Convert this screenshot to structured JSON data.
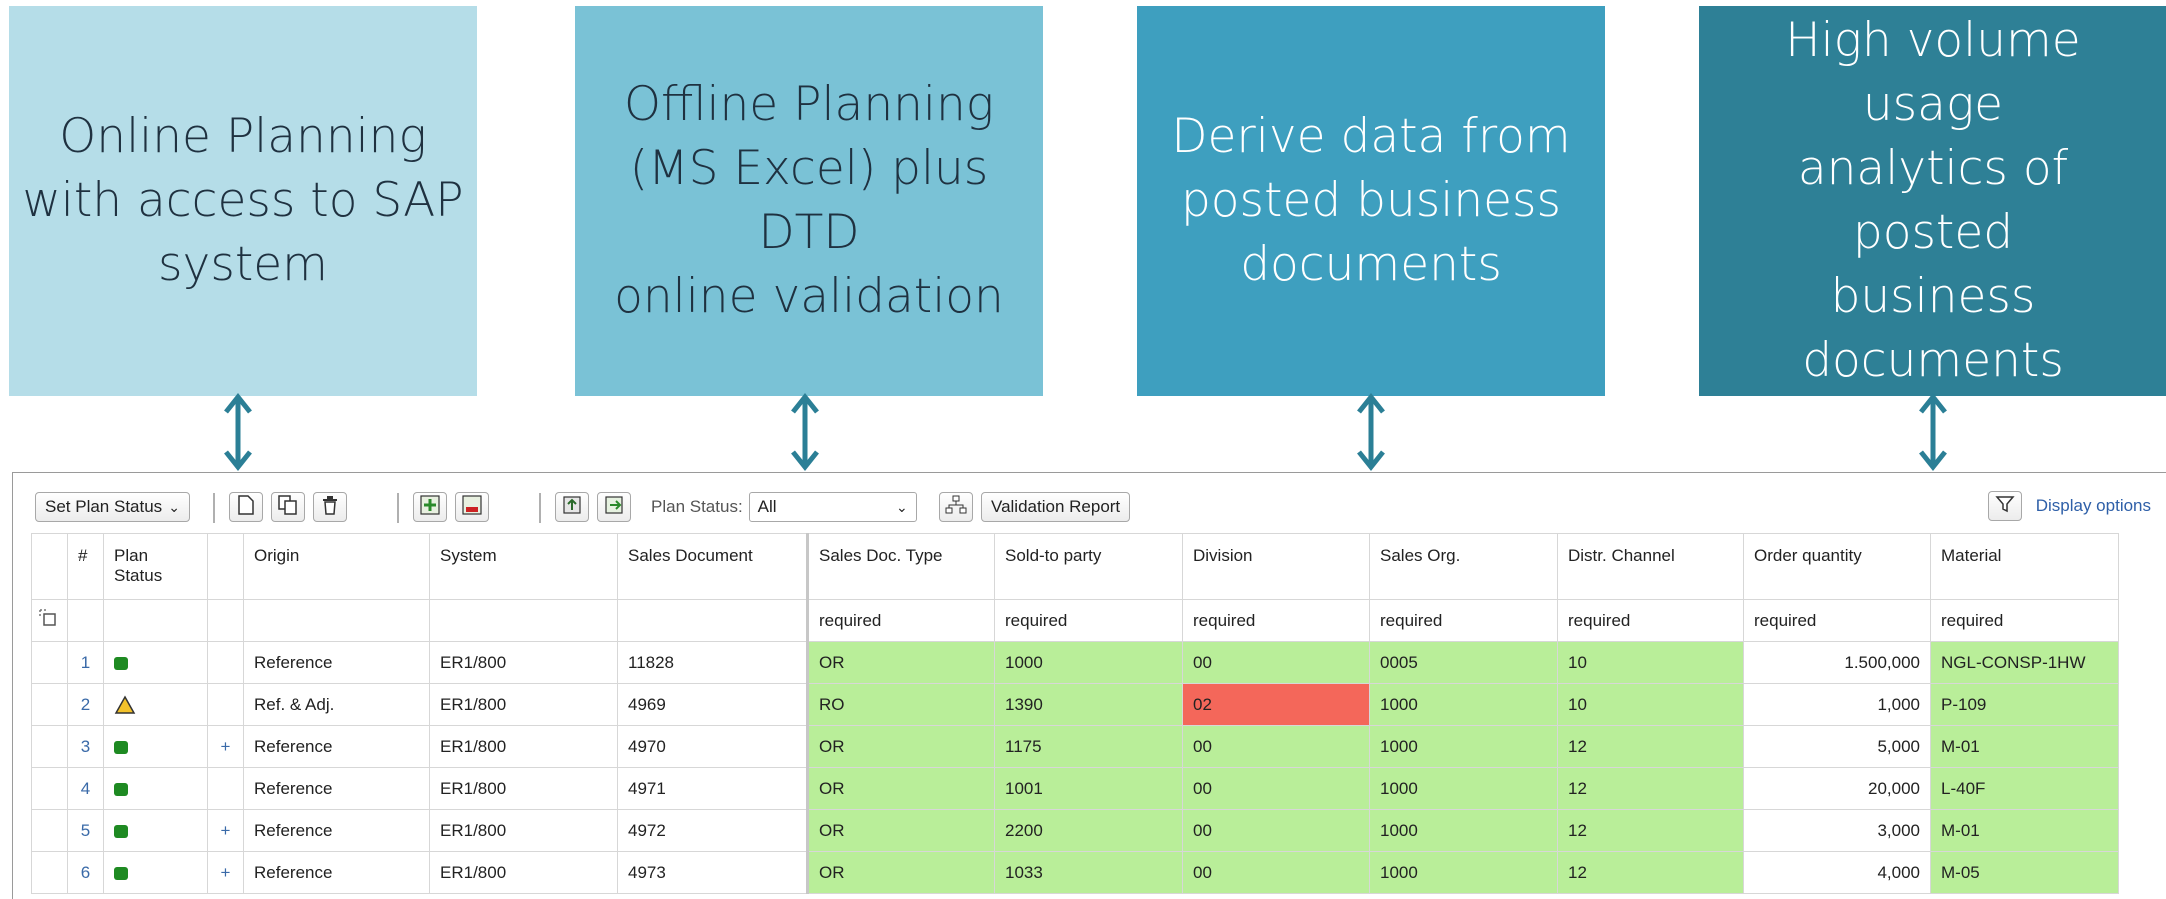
{
  "boxes": [
    {
      "lines": [
        "Online Planning",
        "with access to SAP",
        "system"
      ],
      "color": "#b5dde8"
    },
    {
      "lines": [
        "Offline Planning",
        "(MS Excel) plus DTD",
        "online validation"
      ],
      "color": "#7ac2d6"
    },
    {
      "lines": [
        "Derive data from",
        "posted business",
        "documents"
      ],
      "color": "#3e9fbf"
    },
    {
      "lines": [
        "High volume usage",
        "analytics of posted",
        "business",
        "documents"
      ],
      "color": "#2e8096"
    }
  ],
  "toolbar": {
    "set_plan_status": "Set Plan Status",
    "plan_status_label": "Plan Status:",
    "plan_status_value": "All",
    "validation_report": "Validation Report",
    "display_options": "Display options"
  },
  "table": {
    "headers": {
      "num": "#",
      "plan_status_1": "Plan",
      "plan_status_2": "Status",
      "origin": "Origin",
      "system": "System",
      "sales_document": "Sales Document",
      "sales_doc_type": "Sales Doc. Type",
      "sold_to_party": "Sold-to party",
      "division": "Division",
      "sales_org": "Sales Org.",
      "distr_channel": "Distr. Channel",
      "order_quantity": "Order quantity",
      "material": "Material"
    },
    "required_label": "required",
    "rows": [
      {
        "num": "1",
        "status": "ok",
        "plus": "",
        "origin": "Reference",
        "system": "ER1/800",
        "sales_document": "11828",
        "sales_doc_type": "OR",
        "sold_to_party": "1000",
        "division": "00",
        "sales_org": "0005",
        "distr_channel": "10",
        "order_quantity": "1.500,000",
        "material": "NGL-CONSP-1HW"
      },
      {
        "num": "2",
        "status": "warning",
        "plus": "",
        "origin": "Ref. & Adj.",
        "system": "ER1/800",
        "sales_document": "4969",
        "sales_doc_type": "RO",
        "sold_to_party": "1390",
        "division": "02",
        "sales_org": "1000",
        "distr_channel": "10",
        "order_quantity": "1,000",
        "material": "P-109"
      },
      {
        "num": "3",
        "status": "ok",
        "plus": "+",
        "origin": "Reference",
        "system": "ER1/800",
        "sales_document": "4970",
        "sales_doc_type": "OR",
        "sold_to_party": "1175",
        "division": "00",
        "sales_org": "1000",
        "distr_channel": "12",
        "order_quantity": "5,000",
        "material": "M-01"
      },
      {
        "num": "4",
        "status": "ok",
        "plus": "",
        "origin": "Reference",
        "system": "ER1/800",
        "sales_document": "4971",
        "sales_doc_type": "OR",
        "sold_to_party": "1001",
        "division": "00",
        "sales_org": "1000",
        "distr_channel": "12",
        "order_quantity": "20,000",
        "material": "L-40F"
      },
      {
        "num": "5",
        "status": "ok",
        "plus": "+",
        "origin": "Reference",
        "system": "ER1/800",
        "sales_document": "4972",
        "sales_doc_type": "OR",
        "sold_to_party": "2200",
        "division": "00",
        "sales_org": "1000",
        "distr_channel": "12",
        "order_quantity": "3,000",
        "material": "M-01"
      },
      {
        "num": "6",
        "status": "ok",
        "plus": "+",
        "origin": "Reference",
        "system": "ER1/800",
        "sales_document": "4973",
        "sales_doc_type": "OR",
        "sold_to_party": "1033",
        "division": "00",
        "sales_org": "1000",
        "distr_channel": "12",
        "order_quantity": "4,000",
        "material": "M-05"
      }
    ]
  },
  "colors": {
    "valid_cell": "#b9ee99",
    "error_cell": "#f4675a",
    "arrow": "#2b7f96",
    "status_ok": "#1e8a22",
    "status_warning": "#f3c22b"
  },
  "icons": [
    "new-row-icon",
    "copy-row-icon",
    "delete-icon",
    "excel-import-icon",
    "excel-export-icon",
    "upload-icon",
    "download-icon",
    "hierarchy-icon",
    "filter-icon",
    "multi-select-icon"
  ]
}
